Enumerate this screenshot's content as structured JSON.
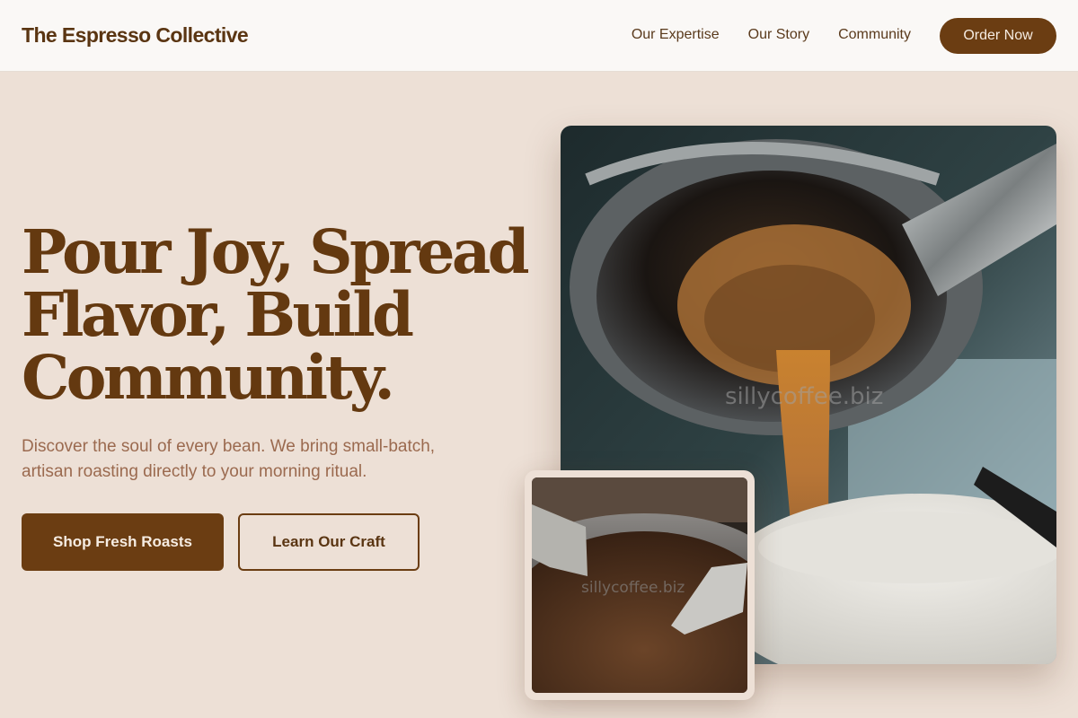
{
  "header": {
    "brand": "The Espresso Collective",
    "nav": [
      "Our Expertise",
      "Our Story",
      "Community"
    ],
    "cta": "Order Now"
  },
  "hero": {
    "headline_lines": [
      "Pour Joy, Spread",
      "Flavor, Build",
      "Community."
    ],
    "subtext": "Discover the soul of every bean. We bring small-batch, artisan roasting directly to your morning ritual.",
    "primary_button": "Shop Fresh Roasts",
    "secondary_button": "Learn Our Craft"
  },
  "images": {
    "main_watermark": "sillycoffee.biz",
    "secondary_watermark": "sillycoffee.biz"
  },
  "colors": {
    "brand_brown": "#6b3d12",
    "page_bg": "#ede0d6",
    "header_bg": "#faf8f6",
    "subtext": "#9b6a4f"
  }
}
